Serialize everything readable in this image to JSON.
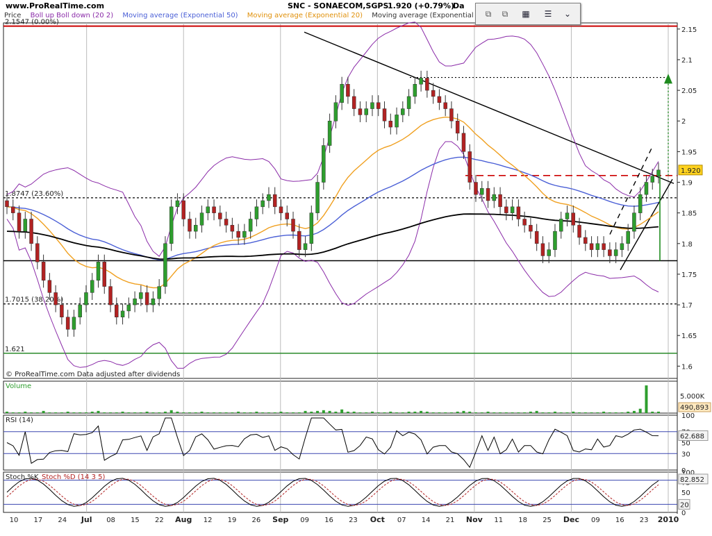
{
  "header": {
    "site": "www.ProRealTime.com",
    "title": "SNC - SONAECOM,SGPS",
    "price_change": "1.920 (+0.79%)",
    "extra": "Da"
  },
  "legend": {
    "price": "Price",
    "boll": "Boll up Boll down (20 2)",
    "ema50": "Moving average (Exponential 50)",
    "ema20": "Moving average (Exponential 20)",
    "ma200": "Moving average (Exponential 200)"
  },
  "colors": {
    "up": "#2e9e2e",
    "down": "#b22222",
    "boll": "#8a2aa8",
    "ema50": "#4a5fd6",
    "ema20": "#f0a020",
    "ma200": "#000000",
    "red_line": "#cc0000",
    "green_line": "#2a8a2a"
  },
  "toolbar": {
    "icons": [
      "copy-icon",
      "copy-icon",
      "delete-icon",
      "menu-icon",
      "chevron-down-icon"
    ]
  },
  "copyright": "© ProRealTime.com Data adjusted after dividends",
  "chart_data": {
    "type": "candlestick",
    "ylim": [
      1.58,
      2.16
    ],
    "y_ticks": [
      "2.15",
      "2.1",
      "2.05",
      "2",
      "1.95",
      "1.9",
      "1.85",
      "1.8",
      "1.75",
      "1.7",
      "1.65",
      "1.6"
    ],
    "current_price": "1.920",
    "x_tick_labels": [
      "10",
      "17",
      "24",
      "Jul",
      "08",
      "15",
      "22",
      "Aug",
      "12",
      "19",
      "26",
      "Sep",
      "09",
      "16",
      "23",
      "Oct",
      "07",
      "14",
      "21",
      "Nov",
      "11",
      "18",
      "25",
      "Dec",
      "09",
      "16",
      "23",
      "2010"
    ],
    "fib_levels": [
      {
        "label": "2.1547 (0.00%)",
        "value": 2.1547
      },
      {
        "label": "1.8747 (23.60%)",
        "value": 1.8747
      },
      {
        "label": "1.7015 (38.20%)",
        "value": 1.7015
      },
      {
        "label": "1.621",
        "value": 1.621
      }
    ],
    "close_series": [
      1.86,
      1.85,
      1.82,
      1.84,
      1.8,
      1.77,
      1.74,
      1.72,
      1.7,
      1.68,
      1.66,
      1.68,
      1.7,
      1.72,
      1.74,
      1.77,
      1.73,
      1.7,
      1.68,
      1.69,
      1.7,
      1.71,
      1.72,
      1.7,
      1.71,
      1.73,
      1.8,
      1.86,
      1.87,
      1.84,
      1.82,
      1.83,
      1.85,
      1.86,
      1.85,
      1.84,
      1.83,
      1.82,
      1.81,
      1.82,
      1.84,
      1.86,
      1.87,
      1.88,
      1.86,
      1.85,
      1.84,
      1.82,
      1.79,
      1.8,
      1.85,
      1.9,
      1.96,
      2.0,
      2.03,
      2.06,
      2.04,
      2.02,
      2.01,
      2.02,
      2.03,
      2.02,
      2.0,
      1.99,
      2.01,
      2.02,
      2.04,
      2.06,
      2.07,
      2.05,
      2.04,
      2.03,
      2.02,
      2.0,
      1.98,
      1.95,
      1.9,
      1.88,
      1.89,
      1.87,
      1.88,
      1.86,
      1.85,
      1.86,
      1.84,
      1.83,
      1.82,
      1.8,
      1.78,
      1.79,
      1.82,
      1.84,
      1.85,
      1.83,
      1.81,
      1.8,
      1.79,
      1.8,
      1.79,
      1.78,
      1.79,
      1.8,
      1.82,
      1.85,
      1.88,
      1.9,
      1.91,
      1.92
    ],
    "volume_label": "Volume",
    "volume_ticks": [
      "5.000K"
    ],
    "volume_current": "490,893",
    "volume_series": [
      2,
      1,
      1,
      2,
      1,
      1,
      3,
      1,
      1,
      1,
      2,
      1,
      1,
      1,
      2,
      3,
      1,
      1,
      1,
      2,
      1,
      1,
      1,
      2,
      1,
      1,
      2,
      4,
      2,
      1,
      1,
      1,
      2,
      1,
      1,
      1,
      1,
      1,
      2,
      1,
      1,
      2,
      1,
      1,
      1,
      2,
      1,
      1,
      1,
      3,
      2,
      3,
      4,
      3,
      2,
      5,
      2,
      2,
      1,
      1,
      2,
      1,
      1,
      2,
      1,
      1,
      2,
      2,
      3,
      2,
      1,
      1,
      1,
      1,
      2,
      3,
      2,
      1,
      1,
      2,
      1,
      1,
      1,
      1,
      1,
      1,
      2,
      3,
      1,
      1,
      2,
      1,
      1,
      2,
      1,
      1,
      1,
      1,
      2,
      1,
      1,
      1,
      2,
      3,
      6,
      38,
      2,
      2
    ],
    "rsi": {
      "label": "RSI (14)",
      "ticks": [
        "100",
        "70",
        "50",
        "30",
        "0"
      ],
      "current": "62.688"
    },
    "stoch": {
      "label_k": "Stoch %K",
      "label_d": "Stoch %D (14 3 5)",
      "ticks": [
        "100",
        "75",
        "50",
        "25",
        "0"
      ],
      "current": "82.852",
      "lower_label": "20"
    }
  }
}
